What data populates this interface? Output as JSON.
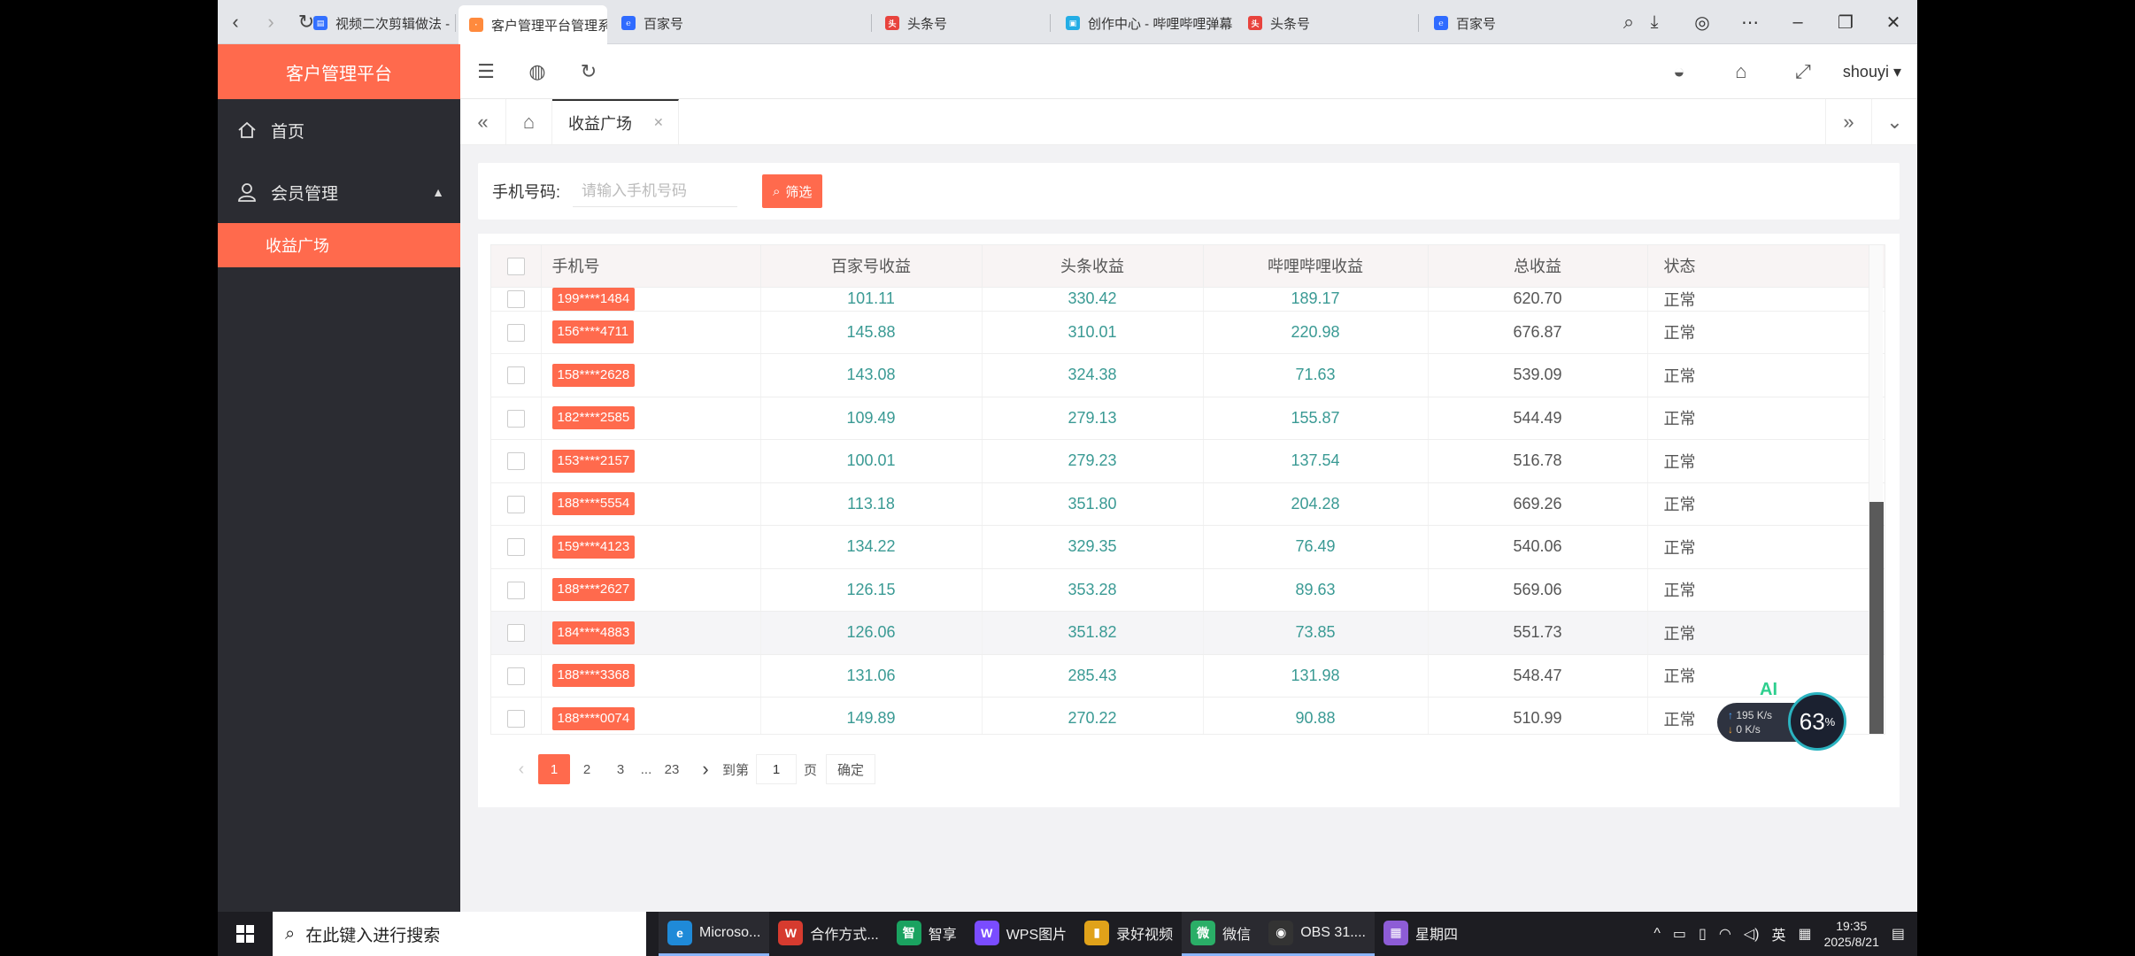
{
  "browser": {
    "tabs": [
      {
        "title": "视频二次剪辑做法 - 飞书",
        "icon_color": "#3370ff"
      },
      {
        "title": "客户管理平台管理系",
        "icon_color": "#ff8a3d"
      },
      {
        "title": "百家号",
        "icon_color": "#2f6bff"
      },
      {
        "title": "头条号",
        "icon_color": "#e8433d"
      },
      {
        "title": "创作中心 - 哔哩哔哩弹幕",
        "icon_color": "#23ade5"
      },
      {
        "title": "头条号",
        "icon_color": "#e8433d"
      },
      {
        "title": "百家号",
        "icon_color": "#2f6bff"
      }
    ]
  },
  "app": {
    "title": "客户管理平台",
    "user": "shouyi",
    "accent": "#ff6a4d"
  },
  "sidebar": {
    "home": "首页",
    "member": "会员管理",
    "sub": "收益广场"
  },
  "tabs_bar": {
    "current": "收益广场"
  },
  "filter": {
    "label": "手机号码:",
    "placeholder": "请输入手机号码",
    "button": "筛选"
  },
  "table": {
    "headers": [
      "手机号",
      "百家号收益",
      "头条收益",
      "哔哩哔哩收益",
      "总收益",
      "状态"
    ],
    "rows": [
      {
        "phone": "199****1484",
        "baijia": "101.11",
        "toutiao": "330.42",
        "bili": "189.17",
        "total": "620.70",
        "status": "正常"
      },
      {
        "phone": "156****4711",
        "baijia": "145.88",
        "toutiao": "310.01",
        "bili": "220.98",
        "total": "676.87",
        "status": "正常"
      },
      {
        "phone": "158****2628",
        "baijia": "143.08",
        "toutiao": "324.38",
        "bili": "71.63",
        "total": "539.09",
        "status": "正常"
      },
      {
        "phone": "182****2585",
        "baijia": "109.49",
        "toutiao": "279.13",
        "bili": "155.87",
        "total": "544.49",
        "status": "正常"
      },
      {
        "phone": "153****2157",
        "baijia": "100.01",
        "toutiao": "279.23",
        "bili": "137.54",
        "total": "516.78",
        "status": "正常"
      },
      {
        "phone": "188****5554",
        "baijia": "113.18",
        "toutiao": "351.80",
        "bili": "204.28",
        "total": "669.26",
        "status": "正常"
      },
      {
        "phone": "159****4123",
        "baijia": "134.22",
        "toutiao": "329.35",
        "bili": "76.49",
        "total": "540.06",
        "status": "正常"
      },
      {
        "phone": "188****2627",
        "baijia": "126.15",
        "toutiao": "353.28",
        "bili": "89.63",
        "total": "569.06",
        "status": "正常"
      },
      {
        "phone": "184****4883",
        "baijia": "126.06",
        "toutiao": "351.82",
        "bili": "73.85",
        "total": "551.73",
        "status": "正常"
      },
      {
        "phone": "188****3368",
        "baijia": "131.06",
        "toutiao": "285.43",
        "bili": "131.98",
        "total": "548.47",
        "status": "正常"
      },
      {
        "phone": "188****0074",
        "baijia": "149.89",
        "toutiao": "270.22",
        "bili": "90.88",
        "total": "510.99",
        "status": "正常"
      }
    ]
  },
  "pager": {
    "pages": [
      "1",
      "2",
      "3",
      "...",
      "23"
    ],
    "goto_label": "到第",
    "goto_value": "1",
    "page_unit": "页",
    "ok": "确定"
  },
  "widget": {
    "ai": "AI",
    "up": "195 K/s",
    "down": "0 K/s",
    "percent": "63",
    "percent_unit": "%"
  },
  "taskbar": {
    "search": "在此键入进行搜索",
    "apps": [
      {
        "label": "Microso...",
        "color": "#1f8ad8",
        "glyph": "e"
      },
      {
        "label": "合作方式...",
        "color": "#d63b2f",
        "glyph": "W"
      },
      {
        "label": "智享",
        "color": "#1aa260",
        "glyph": "智"
      },
      {
        "label": "WPS图片",
        "color": "#7a4cff",
        "glyph": "W"
      },
      {
        "label": "录好视频",
        "color": "#e0a21a",
        "glyph": "▮"
      },
      {
        "label": "微信",
        "color": "#2aae67",
        "glyph": "微"
      },
      {
        "label": "OBS 31....",
        "color": "#333333",
        "glyph": "◉"
      },
      {
        "label": "星期四",
        "color": "#8d5cd6",
        "glyph": "▦"
      }
    ],
    "ime": "英",
    "time": "19:35",
    "date": "2025/8/21"
  }
}
